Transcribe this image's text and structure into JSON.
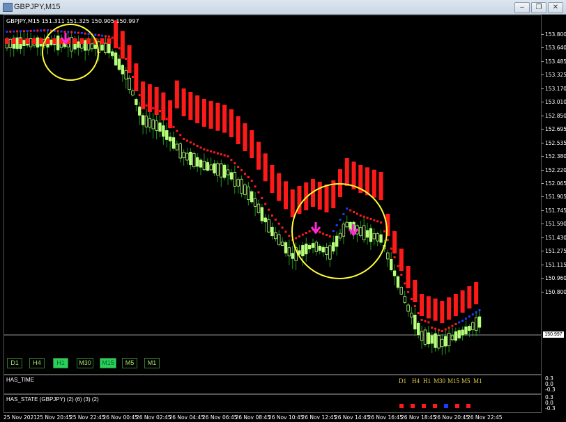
{
  "window": {
    "title": "GBPJPY,M15"
  },
  "chart_header": "GBPJPY,M15  151.311 151.325 150.905 150.997",
  "price_axis": {
    "labels": [
      "153.800",
      "153.640",
      "153.485",
      "153.325",
      "153.170",
      "153.010",
      "152.850",
      "152.695",
      "152.535",
      "152.380",
      "152.220",
      "152.065",
      "151.905",
      "151.745",
      "151.590",
      "151.430",
      "151.275",
      "151.115",
      "150.960",
      "150.800"
    ],
    "current_price": "150.997"
  },
  "timeframes": [
    {
      "label": "D1",
      "active": false
    },
    {
      "label": "H4",
      "active": false
    },
    {
      "label": "H1",
      "active": true
    },
    {
      "label": "M30",
      "active": false
    },
    {
      "label": "M15",
      "active": true
    },
    {
      "label": "M5",
      "active": false
    },
    {
      "label": "M1",
      "active": false
    }
  ],
  "has_time": {
    "title": "HAS_TIME",
    "tf_labels": [
      "D1",
      "H4",
      "H1",
      "M30",
      "M15",
      "M5",
      "M1"
    ],
    "levels": [
      "0.3",
      "0.0",
      "-0.3"
    ]
  },
  "has_state": {
    "title": "HAS_STATE (GBPJPY) (2) (6) (3) (2)",
    "levels": [
      "0.3",
      "0.0",
      "-0.3"
    ],
    "dots": [
      "red",
      "red",
      "red",
      "red",
      "blue",
      "red",
      "red"
    ]
  },
  "time_axis": [
    "25 Nov 2021",
    "25 Nov 20:45",
    "25 Nov 22:45",
    "26 Nov 00:45",
    "26 Nov 02:45",
    "26 Nov 04:45",
    "26 Nov 06:45",
    "26 Nov 08:45",
    "26 Nov 10:45",
    "26 Nov 12:45",
    "26 Nov 14:45",
    "26 Nov 16:45",
    "26 Nov 18:45",
    "26 Nov 20:45",
    "26 Nov 22:45"
  ],
  "colors": {
    "bull": "#b7ff7a",
    "bear": "#1e9b1e",
    "ribbon": "#ff1a1a",
    "signal": "#ff2bd6",
    "highlight": "#ffff33",
    "blue": "#1e3cff"
  }
}
